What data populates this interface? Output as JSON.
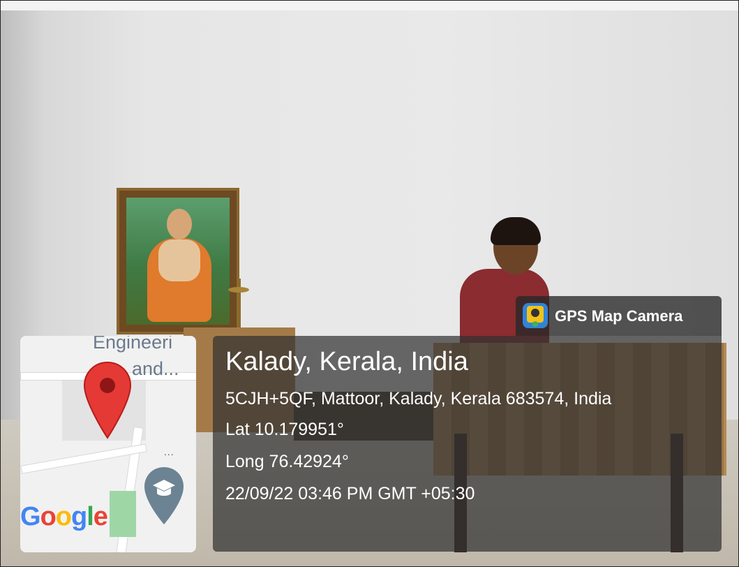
{
  "badge": {
    "app_name": "GPS Map Camera",
    "icon": "gps-map-camera-app-icon"
  },
  "location": {
    "title": "Kalady, Kerala, India",
    "address": "5CJH+5QF, Mattoor, Kalady, Kerala 683574, India",
    "latitude": "Lat 10.179951°",
    "longitude": "Long 76.42924°",
    "timestamp": "22/09/22 03:46 PM GMT +05:30"
  },
  "map": {
    "label_line1": "Engineeri",
    "label_line2": "and...",
    "more": "...",
    "google_logo": [
      "G",
      "o",
      "o",
      "g",
      "l",
      "e"
    ],
    "pin_color": "#E53935",
    "edu_icon": "graduation-cap-icon"
  }
}
